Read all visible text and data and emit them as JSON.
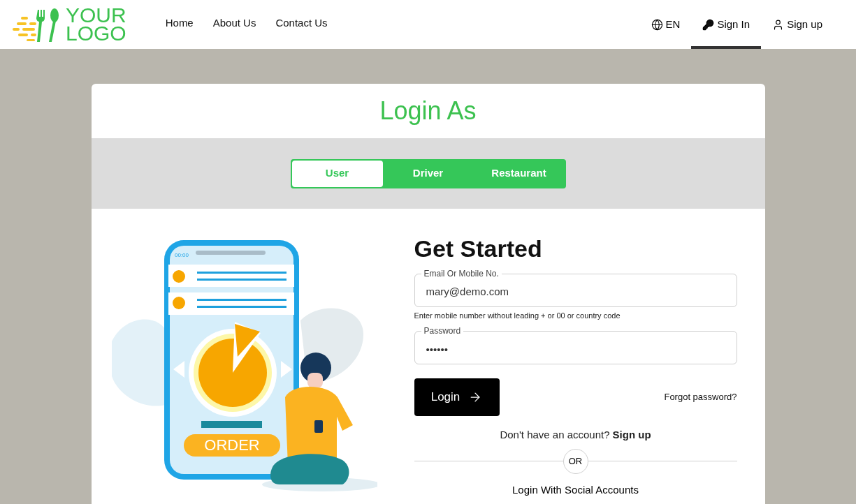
{
  "header": {
    "logo_lines": [
      "YOUR",
      "LOGO"
    ],
    "nav": [
      {
        "label": "Home",
        "selected": false
      },
      {
        "label": "About Us",
        "selected": false
      },
      {
        "label": "Contact Us",
        "selected": false
      }
    ],
    "language": "EN",
    "account_links": [
      {
        "kind": "signin",
        "label": "Sign In",
        "selected": true
      },
      {
        "kind": "signup",
        "label": "Sign up",
        "selected": false
      }
    ]
  },
  "login": {
    "title": "Login As",
    "tabs": [
      {
        "label": "User",
        "selected": true
      },
      {
        "label": "Driver",
        "selected": false
      },
      {
        "label": "Restaurant",
        "selected": false
      }
    ],
    "illustration": {
      "clock": "00:00",
      "button": "ORDER"
    },
    "heading": "Get Started",
    "email": {
      "label": "Email Or Mobile No.",
      "value": "mary@demo.com",
      "hint": "Enter mobile number without leading + or 00 or country code"
    },
    "password": {
      "label": "Password",
      "value": "••••••"
    },
    "submit": "Login",
    "forgot": "Forgot password?",
    "signup_prompt": "Don't have an account?",
    "signup_link": "Sign up",
    "divider": "OR",
    "social": "Login With Social Accounts"
  }
}
